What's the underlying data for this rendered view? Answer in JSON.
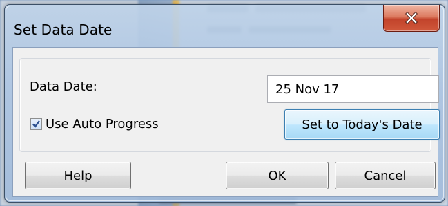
{
  "window": {
    "title": "Set Data Date"
  },
  "data_date": {
    "label": "Data Date:",
    "value": "25 Nov 17"
  },
  "auto_progress": {
    "label": "Use Auto Progress",
    "checked": true
  },
  "buttons": {
    "set_today": "Set to Today's Date",
    "help": "Help",
    "ok": "OK",
    "cancel": "Cancel"
  },
  "icons": {
    "close": "close-icon",
    "check": "checkmark-icon"
  },
  "colors": {
    "close_button": "#c2432b",
    "default_button_border": "#3c7fb1"
  }
}
